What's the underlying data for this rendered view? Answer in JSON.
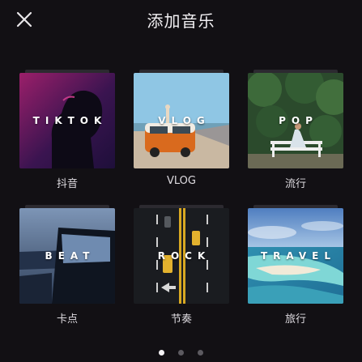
{
  "header": {
    "title": "添加音乐",
    "close_icon": "close-icon"
  },
  "categories": [
    {
      "cover_text": "TIKTOK",
      "caption": "抖音"
    },
    {
      "cover_text": "VLOG",
      "caption": "VLOG"
    },
    {
      "cover_text": "POP",
      "caption": "流行"
    },
    {
      "cover_text": "BEAT",
      "caption": "卡点"
    },
    {
      "cover_text": "ROCK",
      "caption": "节奏"
    },
    {
      "cover_text": "TRAVEL",
      "caption": "旅行"
    }
  ],
  "pagination": {
    "pages": 3,
    "current": 1
  },
  "colors": {
    "background": "#121014",
    "active_dot": "#f4f2f5",
    "inactive_dot": "#5c5a60"
  }
}
